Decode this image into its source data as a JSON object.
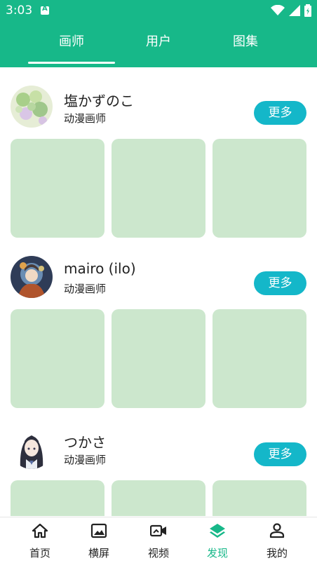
{
  "status": {
    "time": "3:03"
  },
  "tabs": [
    "画师",
    "用户",
    "图集"
  ],
  "artists": [
    {
      "name": "塩かずのこ",
      "role": "动漫画师",
      "more": "更多"
    },
    {
      "name": "mairo (ilo)",
      "role": "动漫画师",
      "more": "更多"
    },
    {
      "name": "つかさ",
      "role": "动漫画师",
      "more": "更多"
    }
  ],
  "nav": [
    "首页",
    "横屏",
    "视频",
    "发现",
    "我的"
  ],
  "colors": {
    "primary": "#17b889",
    "button": "#14b7c9",
    "placeholder": "#cce7cd"
  }
}
